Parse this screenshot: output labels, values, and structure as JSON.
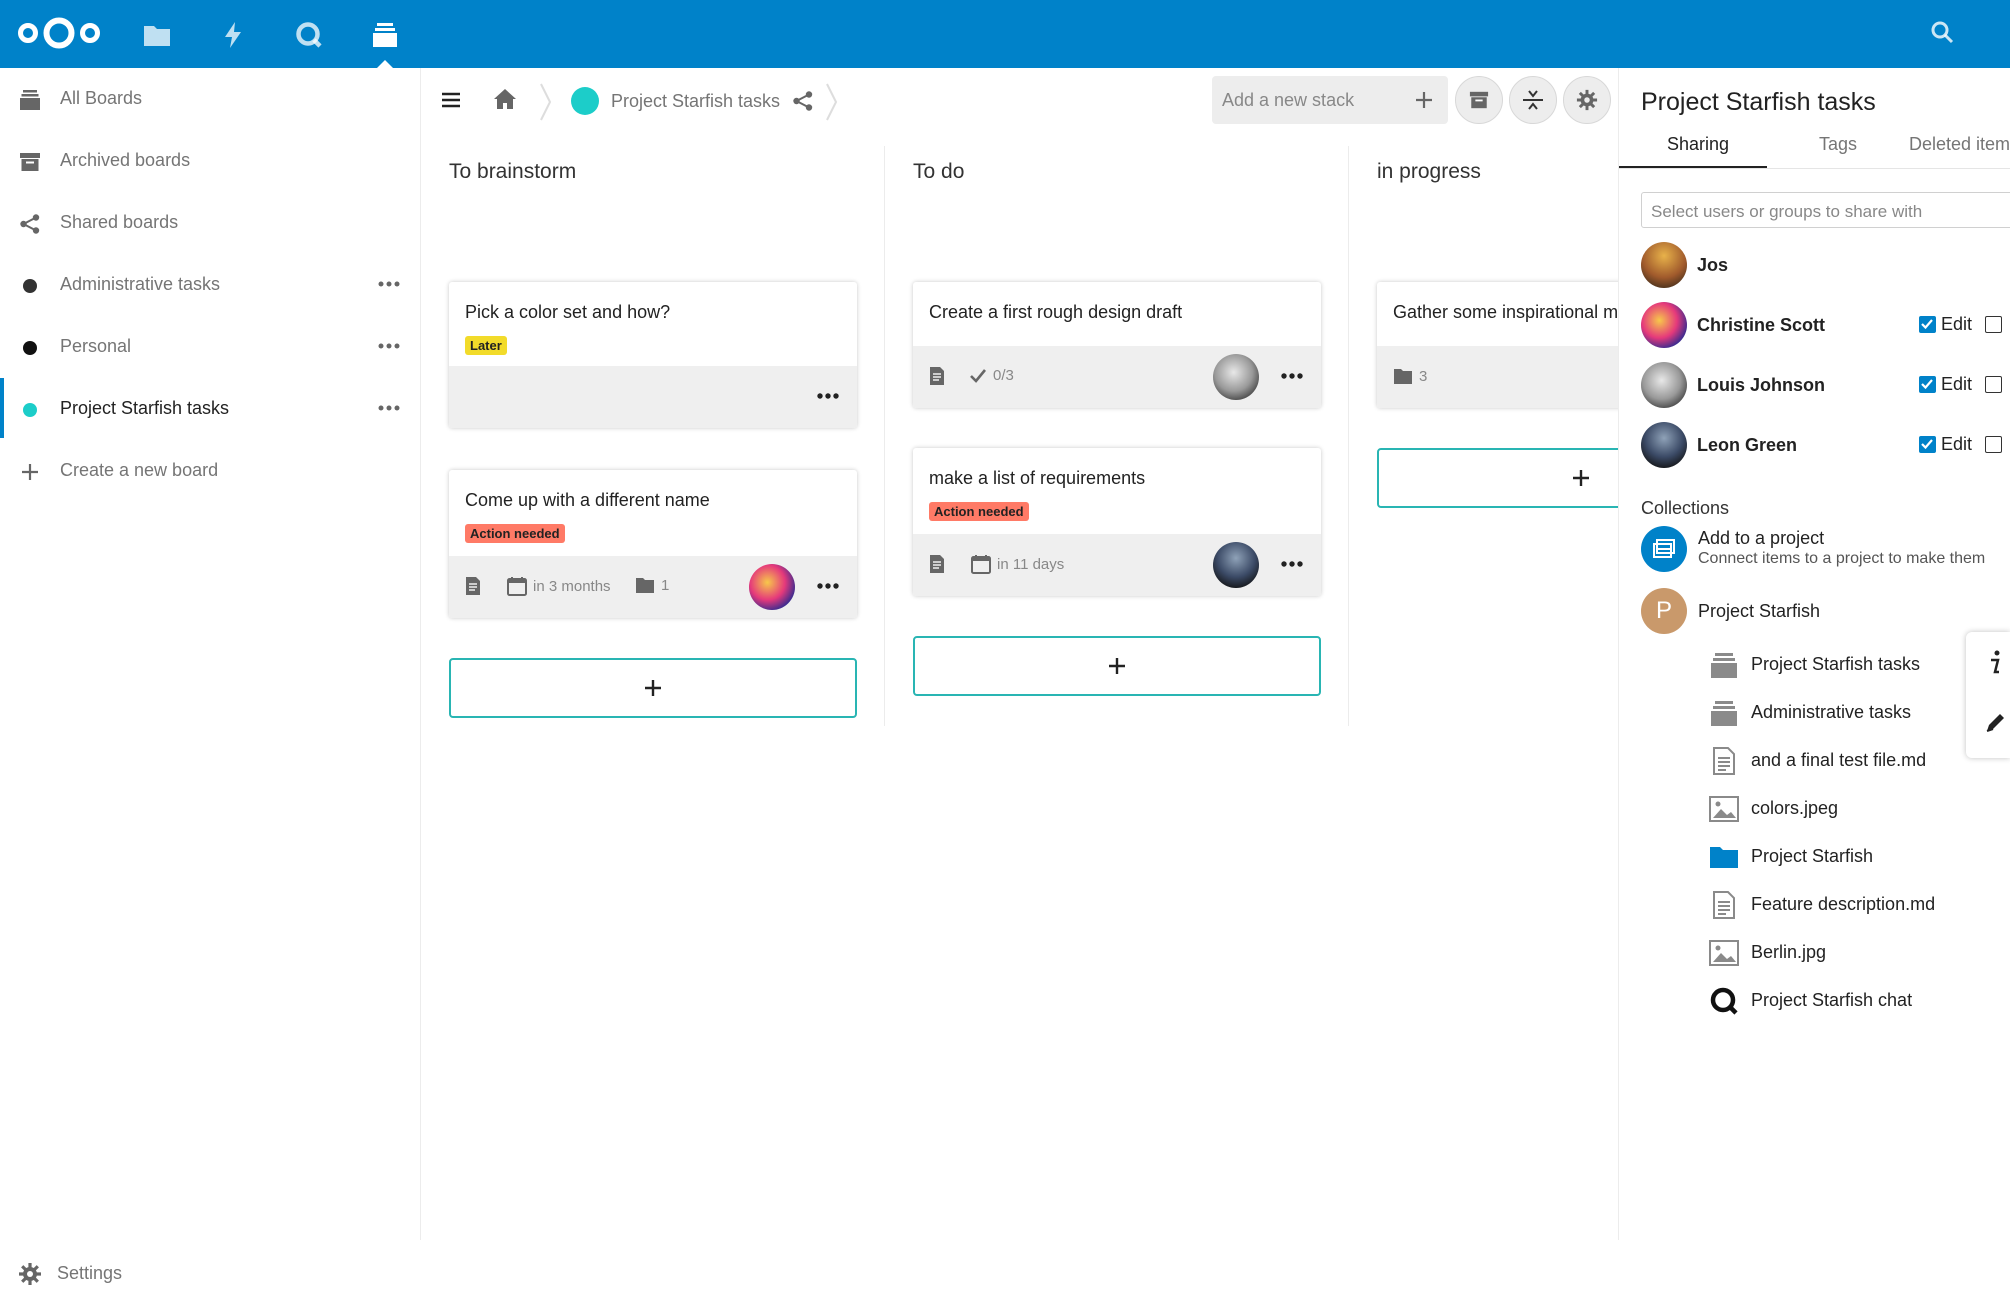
{
  "header": {
    "apps": [
      {
        "name": "Files",
        "icon": "folder-icon"
      },
      {
        "name": "Activity",
        "icon": "lightning-icon"
      },
      {
        "name": "Talk",
        "icon": "talk-icon"
      },
      {
        "name": "Deck",
        "icon": "deck-icon",
        "active": true
      }
    ],
    "brand_color": "#0082c9"
  },
  "nav": {
    "items": [
      {
        "label": "All Boards",
        "icon": "boards-icon"
      },
      {
        "label": "Archived boards",
        "icon": "archive-icon"
      },
      {
        "label": "Shared boards",
        "icon": "share-icon"
      },
      {
        "label": "Administrative tasks",
        "color": "#333333"
      },
      {
        "label": "Personal",
        "color": "#111111"
      },
      {
        "label": "Project Starfish tasks",
        "color": "#1ccdc9",
        "active": true
      },
      {
        "label": "Create a new board",
        "icon": "plus-icon"
      }
    ],
    "settings_label": "Settings"
  },
  "toolbar": {
    "board_title": "Project Starfish tasks",
    "board_color": "#1ccdc9",
    "add_stack_placeholder": "Add a new stack"
  },
  "stacks": [
    {
      "title": "To brainstorm",
      "cards": [
        {
          "title": "Pick a color set and how?",
          "tag": {
            "label": "Later",
            "color": "#f2db2a"
          }
        },
        {
          "title": "Come up with a different name",
          "tag": {
            "label": "Action needed",
            "color": "#ff7a66"
          },
          "due": "in 3 months",
          "attachments": "1"
        }
      ]
    },
    {
      "title": "To do",
      "cards": [
        {
          "title": "Create a first rough design draft",
          "checklist": "0/3"
        },
        {
          "title": "make a list of requirements",
          "tag": {
            "label": "Action needed",
            "color": "#ff7a66"
          },
          "due": "in 11 days"
        }
      ]
    },
    {
      "title": "in progress",
      "cards": [
        {
          "title": "Gather some inspirational m",
          "attachments": "3"
        }
      ]
    }
  ],
  "sidebar": {
    "title": "Project Starfish tasks",
    "tabs": [
      "Sharing",
      "Tags",
      "Deleted item"
    ],
    "share_placeholder": "Select users or groups to share with",
    "sharees": [
      {
        "name": "Jos"
      },
      {
        "name": "Christine Scott",
        "edit_label": "Edit",
        "edit": true
      },
      {
        "name": "Louis Johnson",
        "edit_label": "Edit",
        "edit": true
      },
      {
        "name": "Leon Green",
        "edit_label": "Edit",
        "edit": true
      }
    ],
    "collections": {
      "heading": "Collections",
      "add_title": "Add to a project",
      "add_desc": "Connect items to a project to make them",
      "project": {
        "initial": "P",
        "name": "Project Starfish"
      },
      "resources": [
        {
          "name": "Project Starfish tasks",
          "icon": "deck-board-icon"
        },
        {
          "name": "Administrative tasks",
          "icon": "deck-board-icon"
        },
        {
          "name": "and a final test file.md",
          "icon": "text-file-icon"
        },
        {
          "name": "colors.jpeg",
          "icon": "image-file-icon"
        },
        {
          "name": "Project Starfish",
          "icon": "folder-icon"
        },
        {
          "name": "Feature description.md",
          "icon": "text-file-icon"
        },
        {
          "name": "Berlin.jpg",
          "icon": "image-file-icon"
        },
        {
          "name": "Project Starfish chat",
          "icon": "talk-icon"
        }
      ]
    }
  }
}
